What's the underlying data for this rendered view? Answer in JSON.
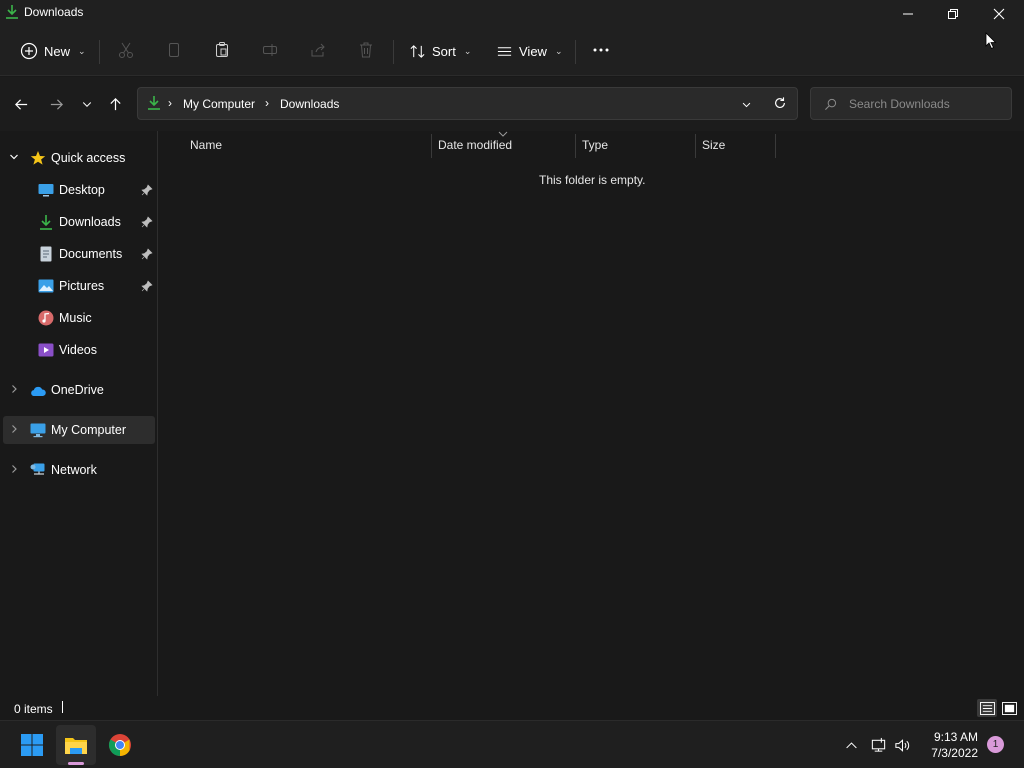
{
  "window": {
    "title": "Downloads",
    "icon": "download-icon"
  },
  "toolbar": {
    "new_label": "New",
    "sort_label": "Sort",
    "view_label": "View",
    "icons": [
      "cut-icon",
      "copy-icon",
      "paste-icon",
      "rename-icon",
      "share-icon",
      "delete-icon",
      "more-icon"
    ]
  },
  "address": {
    "crumbs": [
      "My Computer",
      "Downloads"
    ]
  },
  "search": {
    "placeholder": "Search Downloads"
  },
  "sidebar": {
    "quick_access": "Quick access",
    "items": [
      {
        "label": "Desktop",
        "icon": "desktop-icon",
        "pinned": true
      },
      {
        "label": "Downloads",
        "icon": "download-icon",
        "pinned": true
      },
      {
        "label": "Documents",
        "icon": "document-icon",
        "pinned": true
      },
      {
        "label": "Pictures",
        "icon": "pictures-icon",
        "pinned": true
      },
      {
        "label": "Music",
        "icon": "music-icon",
        "pinned": false
      },
      {
        "label": "Videos",
        "icon": "videos-icon",
        "pinned": false
      }
    ],
    "onedrive": "OneDrive",
    "my_computer": "My Computer",
    "network": "Network"
  },
  "content": {
    "columns": [
      "Name",
      "Date modified",
      "Type",
      "Size"
    ],
    "empty_message": "This folder is empty."
  },
  "status": {
    "items_count": "0 items"
  },
  "taskbar": {
    "apps": [
      "windows-start-icon",
      "file-explorer-icon",
      "chrome-icon"
    ],
    "time": "9:13 AM",
    "date": "7/3/2022",
    "notification_count": "1"
  },
  "colors": {
    "accent_green": "#3bb54a",
    "folder_yellow": "#f5c518",
    "notification_pink": "#d99ad9",
    "windows_blue": "#2b9bf4"
  }
}
